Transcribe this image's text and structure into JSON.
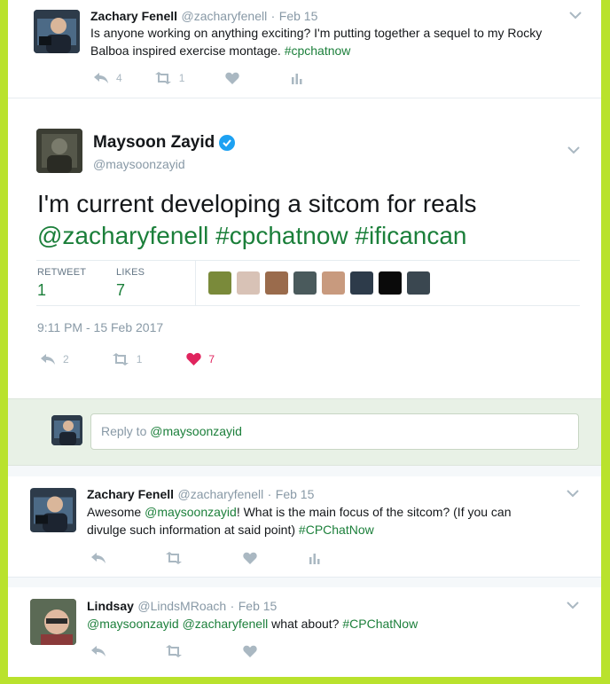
{
  "tweet1": {
    "name": "Zachary Fenell",
    "handle": "@zacharyfenell",
    "sep": "·",
    "date": "Feb 15",
    "text_line1": "Is anyone working on anything exciting? I'm putting together a sequel to my Rocky",
    "text_line2_pre": "Balboa inspired exercise montage. ",
    "hashtag": "#cpchatnow",
    "reply_count": "4",
    "retweet_count": "1"
  },
  "main": {
    "name": "Maysoon Zayid",
    "handle": "@maysoonzayid",
    "text_line1": "I'm current developing a sitcom for reals",
    "text_line2": "@zacharyfenell #cpchatnow #ificancan",
    "retweet_label": "RETWEET",
    "retweet_value": "1",
    "likes_label": "LIKES",
    "likes_value": "7",
    "timestamp": "9:11 PM - 15 Feb 2017",
    "reply_count": "2",
    "retweet_count": "1",
    "like_count": "7"
  },
  "reply_box": {
    "placeholder_pre": "Reply to ",
    "placeholder_mention": "@maysoonzayid"
  },
  "reply1": {
    "name": "Zachary Fenell",
    "handle": "@zacharyfenell",
    "sep": "·",
    "date": "Feb 15",
    "pre": "Awesome ",
    "mention": "@maysoonzayid",
    "post": "! What is the main focus of the sitcom? (If you can",
    "line2_pre": "divulge such information at said point) ",
    "hashtag": "#CPChatNow"
  },
  "reply2": {
    "name": "Lindsay",
    "handle": "@LindsMRoach",
    "sep": "·",
    "date": "Feb 15",
    "mention1": "@maysoonzayid",
    "mention2": "@zacharyfenell",
    "mid": " what about? ",
    "hashtag": "#CPChatNow"
  },
  "colors": {
    "accent": "#1b7f3a",
    "border_green": "#b9e22d",
    "like_red": "#e0245e",
    "verified_blue": "#1da1f2"
  },
  "icons": [
    "reply-icon",
    "retweet-icon",
    "heart-icon",
    "analytics-icon",
    "chevron-down-icon",
    "verified-icon"
  ]
}
